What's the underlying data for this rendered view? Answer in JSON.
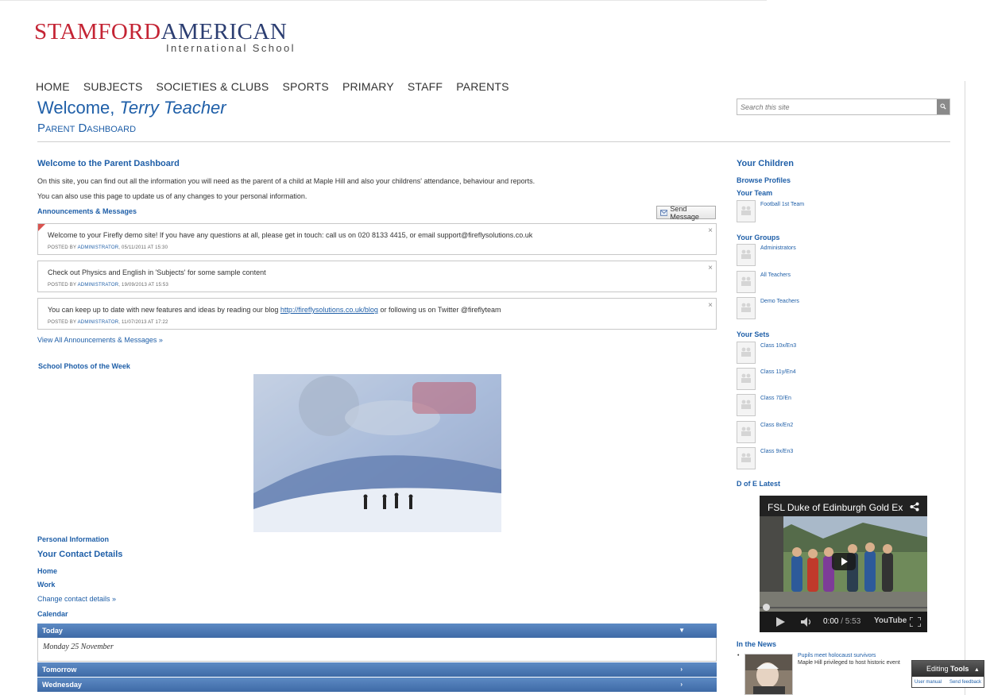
{
  "logo": {
    "part1": "STAMFORD",
    "part2": "AMERICAN",
    "tagline": "International School"
  },
  "nav": [
    "HOME",
    "SUBJECTS",
    "SOCIETIES & CLUBS",
    "SPORTS",
    "PRIMARY",
    "STAFF",
    "PARENTS"
  ],
  "header": {
    "welcome_prefix": "Welcome, ",
    "user_name": "Terry Teacher",
    "subtitle": "Parent Dashboard"
  },
  "search": {
    "placeholder": "Search this site"
  },
  "intro": {
    "title": "Welcome to the Parent Dashboard",
    "line1": "On this site, you can find out all the information you will need as the parent of a child at Maple Hill and also your childrens' attendance, behaviour and reports.",
    "line2": "You can also use this page to update us of any changes to your personal information."
  },
  "announcements": {
    "heading": "Announcements & Messages",
    "send_label": "Send Message",
    "view_all": "View All Announcements & Messages »",
    "items": [
      {
        "text": "Welcome to your Firefly demo site! If you have any questions at all, please get in touch: call us on 020 8133 4415, or email support@fireflysolutions.co.uk",
        "posted_prefix": "POSTED BY ",
        "author": "ADMINISTRATOR",
        "date": ", 05/11/2011 AT 15:30"
      },
      {
        "text": "Check out Physics and English in 'Subjects' for some sample content",
        "posted_prefix": "POSTED BY ",
        "author": "ADMINISTRATOR",
        "date": ", 19/09/2013 AT 15:53"
      },
      {
        "text_before": "You can keep up to date with new features and ideas by reading our blog ",
        "link": "http://fireflysolutions.co.uk/blog",
        "text_after": " or following us on Twitter @fireflyteam",
        "posted_prefix": "POSTED BY ",
        "author": "ADMINISTRATOR",
        "date": ", 11/07/2013 AT 17:22"
      }
    ]
  },
  "photos": {
    "heading": "School Photos of the Week"
  },
  "personal": {
    "heading": "Personal Information",
    "contact_heading": "Your Contact Details",
    "home": "Home",
    "work": "Work",
    "change": "Change contact details »"
  },
  "calendar": {
    "heading": "Calendar",
    "today": "Today",
    "today_date": "Monday 25 November",
    "tomorrow": "Tomorrow",
    "wednesday": "Wednesday"
  },
  "sidebar": {
    "children_heading": "Your Children",
    "browse": "Browse Profiles",
    "team_heading": "Your Team",
    "team": [
      "Football 1st Team"
    ],
    "groups_heading": "Your Groups",
    "groups": [
      "Administrators",
      "All Teachers",
      "Demo Teachers"
    ],
    "sets_heading": "Your Sets",
    "sets": [
      "Class 10x/En3",
      "Class 11y/En4",
      "Class 7D/En",
      "Class 8x/En2",
      "Class 9x/En3"
    ],
    "dofe_heading": "D of E Latest",
    "video": {
      "title": "FSL Duke of Edinburgh Gold Ex",
      "time": "0:00",
      "duration": " / 5:53",
      "brand": "YouTube"
    },
    "news_heading": "In the News",
    "news_title": "Pupils meet holocaust survivors",
    "news_desc": "Maple Hill privileged to host historic event"
  },
  "editing_tools": {
    "label_plain": "Editing ",
    "label_bold": "Tools",
    "user_manual": "User manual",
    "send_feedback": "Send feedback"
  },
  "colors": {
    "brand_red": "#c42434",
    "brand_navy": "#2c3e72",
    "link_blue": "#1f5fa8",
    "calendar_bar": "#4a76b0"
  }
}
